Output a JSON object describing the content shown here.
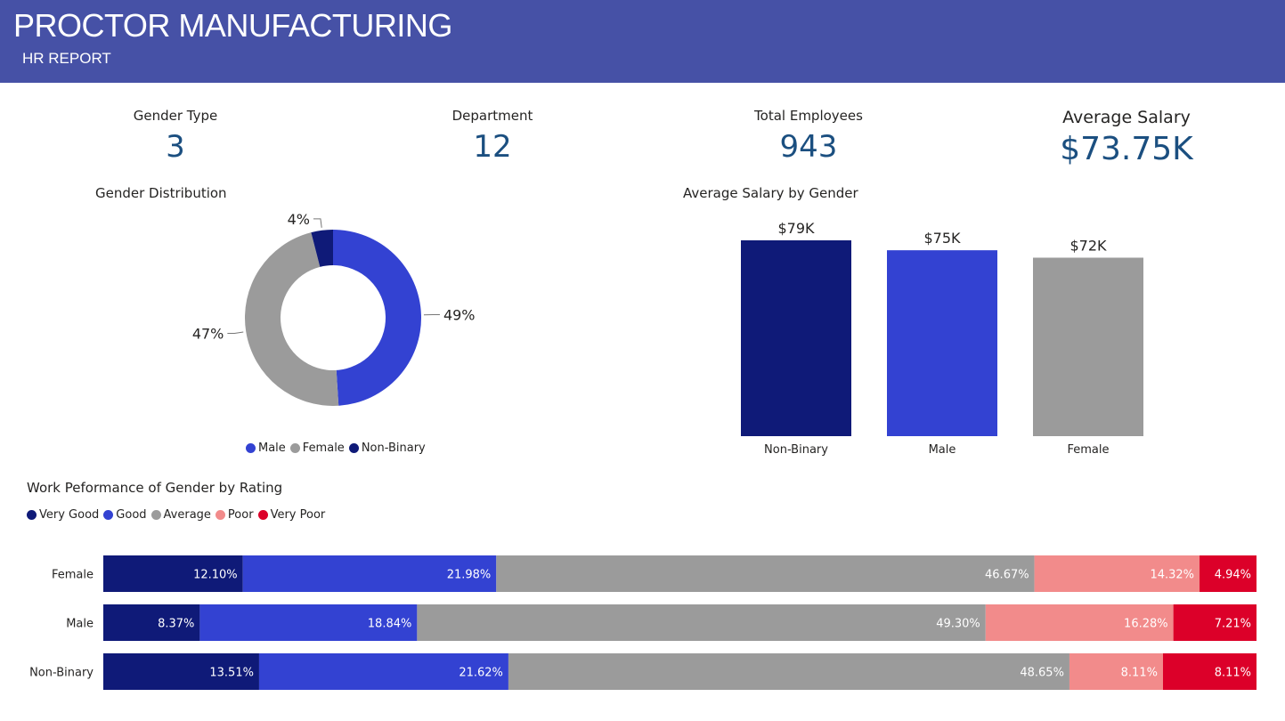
{
  "header": {
    "title": "PROCTOR MANUFACTURING",
    "subtitle": "HR REPORT",
    "background": "#4651a6"
  },
  "kpis": [
    {
      "label": "Gender Type",
      "value": "3"
    },
    {
      "label": "Department",
      "value": "12"
    },
    {
      "label": "Total Employees",
      "value": "943"
    },
    {
      "label": "Average Salary",
      "value": "$73.75K"
    }
  ],
  "colors": {
    "male": "#3342d2",
    "female": "#9b9b9b",
    "non_binary": "#0f1a78",
    "very_good": "#0f1a78",
    "good": "#3342d2",
    "average": "#9b9b9b",
    "poor": "#f28b8b",
    "very_poor": "#dc0029",
    "kpi_value": "#1b4f80"
  },
  "chart_data": [
    {
      "type": "pie",
      "title": "Gender Distribution",
      "categories": [
        "Male",
        "Female",
        "Non-Binary"
      ],
      "values": [
        49,
        47,
        4
      ],
      "data_labels": [
        "49%",
        "47%",
        "4%"
      ],
      "legend": "bottom"
    },
    {
      "type": "bar",
      "title": "Average Salary by Gender",
      "categories": [
        "Non-Binary",
        "Male",
        "Female"
      ],
      "values": [
        79,
        75,
        72
      ],
      "data_labels": [
        "$79K",
        "$75K",
        "$72K"
      ],
      "ylim": [
        0,
        79
      ]
    },
    {
      "type": "bar",
      "orientation": "horizontal-stacked-100",
      "title": "Work Peformance of Gender by Rating",
      "categories": [
        "Female",
        "Male",
        "Non-Binary"
      ],
      "legend": "top-left",
      "series": [
        {
          "name": "Very Good",
          "values": [
            12.1,
            8.37,
            13.51
          ],
          "labels": [
            "12.10%",
            "8.37%",
            "13.51%"
          ]
        },
        {
          "name": "Good",
          "values": [
            21.98,
            18.84,
            21.62
          ],
          "labels": [
            "21.98%",
            "18.84%",
            "21.62%"
          ]
        },
        {
          "name": "Average",
          "values": [
            46.67,
            49.3,
            48.65
          ],
          "labels": [
            "46.67%",
            "49.30%",
            "48.65%"
          ]
        },
        {
          "name": "Poor",
          "values": [
            14.32,
            16.28,
            8.11
          ],
          "labels": [
            "14.32%",
            "16.28%",
            "8.11%"
          ]
        },
        {
          "name": "Very Poor",
          "values": [
            4.94,
            7.21,
            8.11
          ],
          "labels": [
            "4.94%",
            "7.21%",
            "8.11%"
          ]
        }
      ]
    }
  ]
}
